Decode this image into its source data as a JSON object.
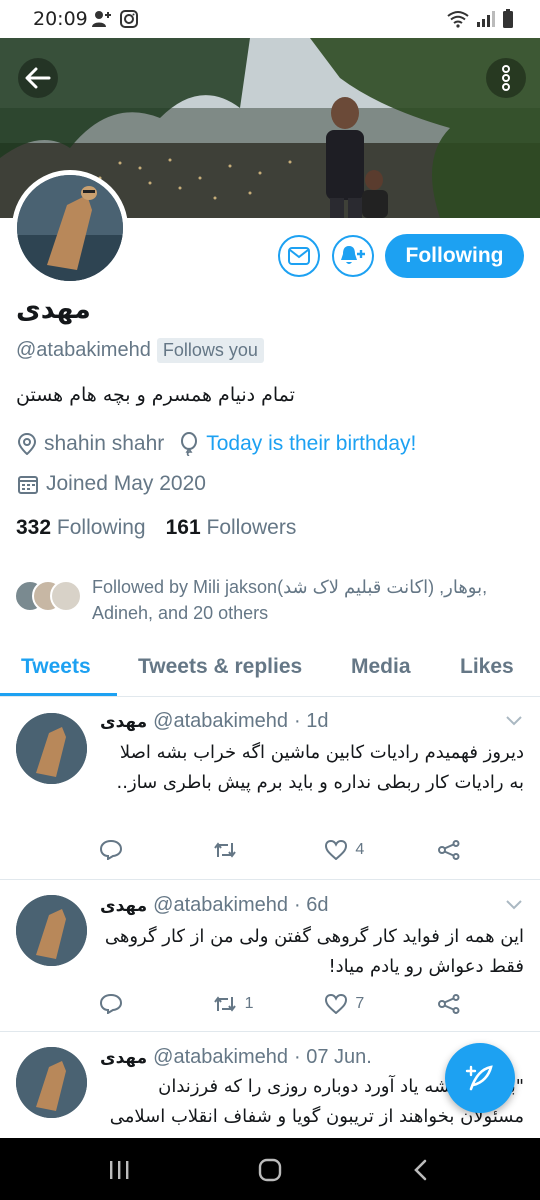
{
  "status_bar": {
    "time": "20:09",
    "icons_left": [
      "person-add-icon",
      "instagram-icon"
    ],
    "icons_right": [
      "wifi-icon",
      "signal-icon",
      "battery-icon"
    ]
  },
  "header": {
    "back_icon": "arrow-left-icon",
    "more_icon": "more-vertical-icon"
  },
  "profile": {
    "display_name": "مهدی",
    "handle": "@atabakimehd",
    "follows_you_badge": "Follows you",
    "bio": "تمام دنیام همسرم و بچه هام هستن",
    "location": "shahin shahr",
    "birthday_text": "Today is their birthday!",
    "joined": "Joined May 2020",
    "following_count": "332",
    "following_label": "Following",
    "followers_count": "161",
    "followers_label": "Followers",
    "followed_by_line1": "Followed by Mili jakson(اکانت قبلیم لاک شد) ,بوهار,",
    "followed_by_line2": "Adineh, and 20 others"
  },
  "actions": {
    "message_icon": "mail-icon",
    "notify_icon": "bell-plus-icon",
    "following_button": "Following"
  },
  "tabs": [
    {
      "label": "Tweets",
      "active": true
    },
    {
      "label": "Tweets & replies",
      "active": false
    },
    {
      "label": "Media",
      "active": false
    },
    {
      "label": "Likes",
      "active": false
    }
  ],
  "tweets": [
    {
      "name": "مهدی",
      "handle": "@atabakimehd",
      "time": "· 1d",
      "text": "دیروز فهمیدم رادیات کابین ماشین اگه خراب بشه اصلا به رادیات کار ربطی نداره و باید برم پیش باطری ساز..",
      "replies": "",
      "retweets": "",
      "likes": "4"
    },
    {
      "name": "مهدی",
      "handle": "@atabakimehd",
      "time": "· 6d",
      "text": "این همه از فواید کار گروهی گفتن ولی من از کار گروهی فقط دعواش رو یادم میاد!",
      "replies": "",
      "retweets": "1",
      "likes": "7"
    },
    {
      "name": "مهدی",
      "handle": "@atabakimehd",
      "time": "· 07 Jun.",
      "text": "\"باورم نمیشه یاد آورد دوباره روزی را که فرزندان مسئولان بخواهند از تریبون گویا و شفاف انقلاب اسلامی به",
      "replies": "",
      "retweets": "",
      "likes": ""
    }
  ],
  "fab_icon": "compose-feather-icon",
  "navbar": [
    "recents-icon",
    "home-icon",
    "back-icon"
  ],
  "colors": {
    "accent": "#1da1f2",
    "text_primary": "#14171a",
    "text_secondary": "#657786"
  }
}
